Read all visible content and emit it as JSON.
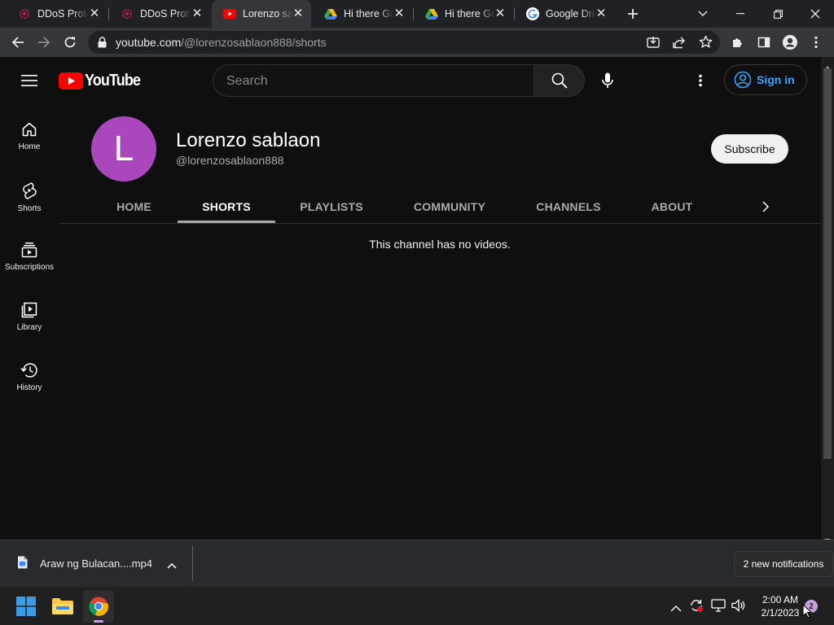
{
  "browser": {
    "tabs": [
      {
        "title": "DDoS Protection by Cloudflare",
        "icon": "cloudflare-icon",
        "active": false
      },
      {
        "title": "DDoS Protection by Cloudflare",
        "icon": "cloudflare-icon",
        "active": false
      },
      {
        "title": "Lorenzo sablaon - YouTube",
        "icon": "youtube-icon",
        "active": true
      },
      {
        "title": "Hi there Google Drive",
        "icon": "google-drive-icon",
        "active": false
      },
      {
        "title": "Hi there Google Drive",
        "icon": "google-drive-icon",
        "active": false
      },
      {
        "title": "Google Drive",
        "icon": "google-icon",
        "active": false
      }
    ],
    "address": {
      "host": "youtube.com",
      "path": "/@lorenzosablaon888/shorts"
    }
  },
  "youtube": {
    "logo_text": "YouTube",
    "search_placeholder": "Search",
    "sign_in_label": "Sign in",
    "guide": [
      {
        "label": "Home",
        "icon": "home-icon"
      },
      {
        "label": "Shorts",
        "icon": "shorts-icon"
      },
      {
        "label": "Subscriptions",
        "icon": "subscriptions-icon"
      },
      {
        "label": "Library",
        "icon": "library-icon"
      },
      {
        "label": "History",
        "icon": "history-icon"
      }
    ],
    "channel": {
      "avatar_letter": "L",
      "avatar_color": "#ab47bc",
      "name": "Lorenzo sablaon",
      "handle": "@lorenzosablaon888",
      "subscribe_label": "Subscribe"
    },
    "channel_tabs": [
      {
        "label": "HOME",
        "active": false
      },
      {
        "label": "SHORTS",
        "active": true
      },
      {
        "label": "PLAYLISTS",
        "active": false
      },
      {
        "label": "COMMUNITY",
        "active": false
      },
      {
        "label": "CHANNELS",
        "active": false
      },
      {
        "label": "ABOUT",
        "active": false
      }
    ],
    "empty_message": "This channel has no videos."
  },
  "download_shelf": {
    "file_name": "Araw ng Bulacan....mp4",
    "notification_text": "2 new notifications"
  },
  "taskbar": {
    "time": "2:00 AM",
    "date": "2/1/2023",
    "notification_count": "2"
  },
  "colors": {
    "youtube_red": "#ff0000",
    "link_blue": "#3ea6ff",
    "page_bg": "#0f0f0f"
  }
}
